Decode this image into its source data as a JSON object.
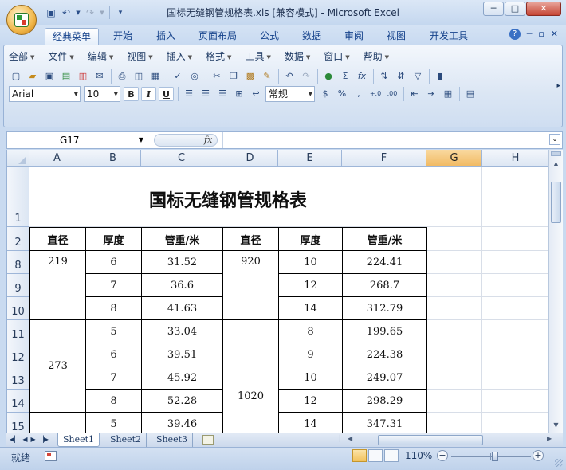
{
  "window": {
    "title": "国标无缝钢管规格表.xls  [兼容模式] - Microsoft Excel",
    "min_label": "─",
    "max_label": "□",
    "close_label": "✕"
  },
  "ribbon_tabs": [
    "经典菜单",
    "开始",
    "插入",
    "页面布局",
    "公式",
    "数据",
    "审阅",
    "视图",
    "开发工具"
  ],
  "ribbon_right": {
    "min": "─",
    "restore": "▫",
    "close": "✕"
  },
  "classic_menu": [
    "全部",
    "文件",
    "编辑",
    "视图",
    "插入",
    "格式",
    "工具",
    "数据",
    "窗口",
    "帮助"
  ],
  "toolbar": {
    "font_name": "Arial",
    "font_size": "10",
    "bold": "B",
    "italic": "I",
    "underline": "U",
    "number_format": "常规",
    "sigma": "Σ",
    "fx": "fx",
    "percent": "%",
    "comma": ","
  },
  "formula_bar": {
    "name_box": "G17",
    "fx_label": "fx",
    "formula": ""
  },
  "columns": [
    "A",
    "B",
    "C",
    "D",
    "E",
    "F",
    "G",
    "H"
  ],
  "rows": [
    "1",
    "2",
    "8",
    "9",
    "10",
    "11",
    "12",
    "13",
    "14",
    "15"
  ],
  "sheet": {
    "title": "国标无缝钢管规格表",
    "headers": [
      "直径",
      "厚度",
      "管重/米",
      "直径",
      "厚度",
      "管重/米"
    ],
    "left_groups": [
      {
        "diameter": "219",
        "rows": [
          [
            "6",
            "31.52"
          ],
          [
            "7",
            "36.6"
          ],
          [
            "8",
            "41.63"
          ]
        ]
      },
      {
        "diameter": "273",
        "rows": [
          [
            "5",
            "33.04"
          ],
          [
            "6",
            "39.51"
          ],
          [
            "7",
            "45.92"
          ],
          [
            "8",
            "52.28"
          ]
        ]
      },
      {
        "diameter": "",
        "rows": [
          [
            "5",
            "39.46"
          ]
        ]
      }
    ],
    "right_groups": [
      {
        "diameter": "920",
        "rows": [
          [
            "10",
            "224.41"
          ],
          [
            "12",
            "268.7"
          ],
          [
            "14",
            "312.79"
          ]
        ]
      },
      {
        "diameter": "1020",
        "rows": [
          [
            "8",
            "199.65"
          ],
          [
            "9",
            "224.38"
          ],
          [
            "10",
            "249.07"
          ],
          [
            "12",
            "298.29"
          ],
          [
            "14",
            "347.31"
          ]
        ]
      }
    ]
  },
  "sheet_tabs": [
    "Sheet1",
    "Sheet2",
    "Sheet3"
  ],
  "active_sheet": "Sheet1",
  "status": {
    "ready": "就绪",
    "zoom": "110%",
    "zoom_fraction": 0.55
  }
}
